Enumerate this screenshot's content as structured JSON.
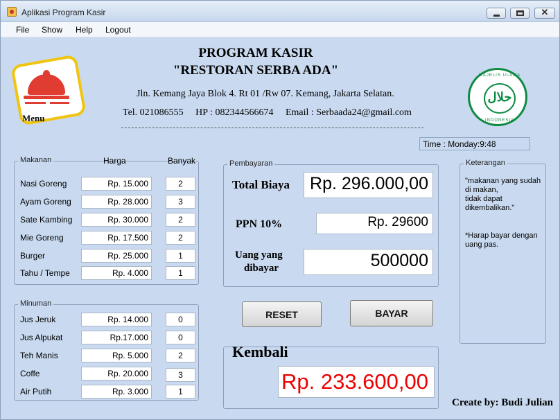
{
  "window": {
    "title": "Aplikasi Program Kasir"
  },
  "menubar": [
    "File",
    "Show",
    "Help",
    "Logout"
  ],
  "logo": {
    "label": "Menu"
  },
  "header": {
    "title": "PROGRAM KASIR",
    "subtitle": "\"RESTORAN SERBA ADA\"",
    "address": "Jln. Kemang Jaya Blok 4. Rt 01 /Rw 07. Kemang, Jakarta Selatan.",
    "contacts": "Tel. 021086555     HP : 082344566674     Email : Serbaada24@gmail.com"
  },
  "halal": {
    "top_text": "MAJELIS ULAMA",
    "bottom_text": "INDONESIA",
    "mark": "حلال"
  },
  "time": "Time : Monday:9:48",
  "makanan": {
    "legend": "Makanan",
    "col_price": "Harga",
    "col_qty": "Banyak",
    "items": [
      {
        "name": "Nasi Goreng",
        "price": "Rp. 15.000",
        "qty": "2"
      },
      {
        "name": "Ayam Goreng",
        "price": "Rp. 28.000",
        "qty": "3"
      },
      {
        "name": "Sate Kambing",
        "price": "Rp. 30.000",
        "qty": "2"
      },
      {
        "name": "Mie Goreng",
        "price": "Rp. 17.500",
        "qty": "2"
      },
      {
        "name": "Burger",
        "price": "Rp. 25.000",
        "qty": "1"
      },
      {
        "name": "Tahu / Tempe",
        "price": "Rp. 4.000",
        "qty": "1"
      }
    ]
  },
  "minuman": {
    "legend": "Minuman",
    "items": [
      {
        "name": "Jus Jeruk",
        "price": "Rp. 14.000",
        "qty": "0"
      },
      {
        "name": "Jus Alpukat",
        "price": "Rp.17.000",
        "qty": "0"
      },
      {
        "name": "Teh Manis",
        "price": "Rp. 5.000",
        "qty": "2"
      },
      {
        "name": "Coffe",
        "price": "Rp. 20.000",
        "qty": "3"
      },
      {
        "name": "Air Putih",
        "price": "Rp. 3.000",
        "qty": "1"
      }
    ]
  },
  "pembayaran": {
    "legend": "Pembayaran",
    "total_label": "Total Biaya",
    "total_value": "Rp. 296.000,00",
    "ppn_label": "PPN 10%",
    "ppn_value": "Rp. 29600",
    "paid_label_1": "Uang yang",
    "paid_label_2": "dibayar",
    "paid_value": "500000"
  },
  "buttons": {
    "reset": "RESET",
    "bayar": "BAYAR"
  },
  "kembali": {
    "label": "Kembali",
    "value": "Rp. 233.600,00"
  },
  "keterangan": {
    "legend": "Keterangan",
    "note1_l1": "\"makanan yang sudah",
    "note1_l2": "di makan,",
    "note1_l3": " tidak dapat",
    "note1_l4": "dikembalikan.\"",
    "note2_l1": "*Harap bayar dengan",
    "note2_l2": "uang pas."
  },
  "footer": {
    "creator": "Create by: Budi Julian"
  },
  "colors": {
    "background": "#c9daf0",
    "accent_red": "#e00000",
    "halal_green": "#0f8a43",
    "logo_yellow": "#f1c40f"
  }
}
